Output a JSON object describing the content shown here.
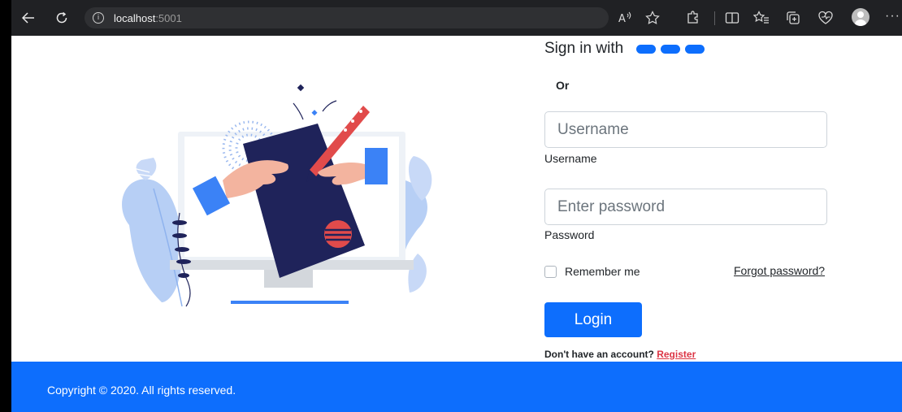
{
  "browser": {
    "address_host": "localhost",
    "address_port": ":5001",
    "icons": [
      "back-arrow-icon",
      "refresh-icon",
      "info-icon",
      "read-aloud-icon",
      "favorite-star-icon",
      "extensions-icon",
      "split-screen-icon",
      "favorites-icon",
      "collections-icon",
      "browser-essentials-icon",
      "profile-avatar-icon",
      "more-options-icon"
    ]
  },
  "login": {
    "signin_text": "Sign in with",
    "or_text": "Or",
    "username_placeholder": "Username",
    "username_label": "Username",
    "password_placeholder": "Enter password",
    "password_label": "Password",
    "remember_label": "Remember me",
    "forgot_label": "Forgot password?",
    "login_label": "Login",
    "no_account_text": "Don't have an account?",
    "register_label": "Register"
  },
  "footer": {
    "copyright": "Copyright © 2020. All rights reserved."
  },
  "colors": {
    "primary": "#0d6efd",
    "register_link": "#dc3545",
    "browser_chrome": "#202124"
  }
}
